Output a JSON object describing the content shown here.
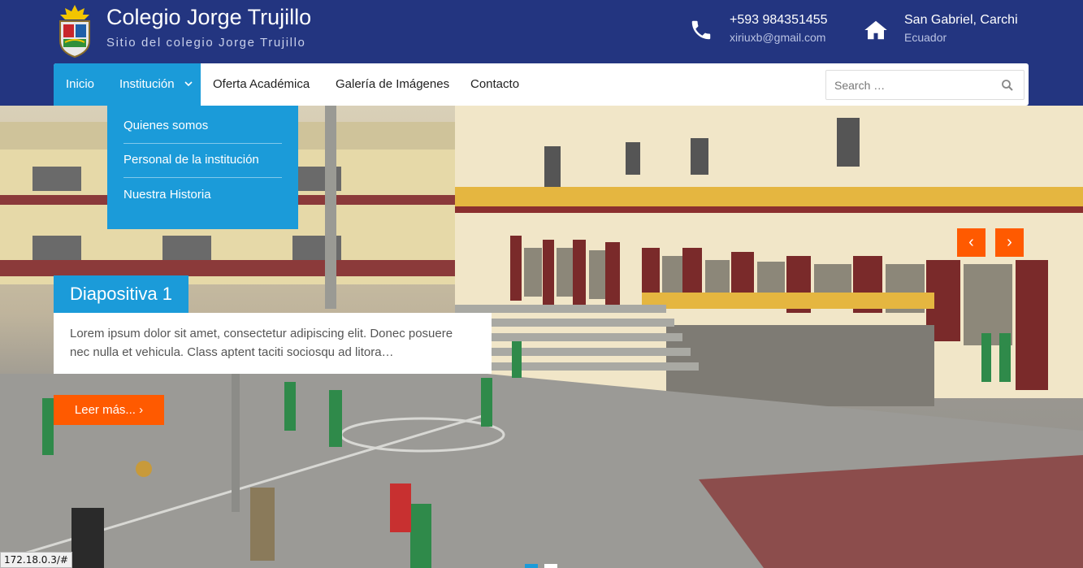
{
  "site": {
    "title": "Colegio Jorge Trujillo",
    "description": "Sitio del colegio Jorge Trujillo",
    "logo_icon": "school-crest-icon"
  },
  "contact": {
    "phone": "+593 984351455",
    "email": "xiriuxb@gmail.com",
    "city": "San Gabriel, Carchi",
    "country": "Ecuador",
    "phone_icon": "phone-icon",
    "location_icon": "home-icon"
  },
  "nav": {
    "items": [
      {
        "label": "Inicio"
      },
      {
        "label": "Institución"
      },
      {
        "label": "Oferta Académica"
      },
      {
        "label": "Galería de Imágenes"
      },
      {
        "label": "Contacto"
      }
    ],
    "dropdown": [
      "Quienes somos",
      "Personal de la institución",
      "Nuestra Historia"
    ]
  },
  "search": {
    "placeholder": "Search …"
  },
  "slider": {
    "title": "Diapositiva 1",
    "text": "Lorem ipsum dolor sit amet, consectetur adipiscing elit. Donec posuere nec nulla et vehicula. Class aptent taciti sociosqu ad litora…",
    "button": "Leer más... ›",
    "prev": "‹",
    "next": "›"
  },
  "status_bar": {
    "url": "172.18.0.3/#"
  },
  "colors": {
    "header_bg": "#233580",
    "accent_blue": "#1b9bd9",
    "accent_orange": "#ff5a00"
  }
}
